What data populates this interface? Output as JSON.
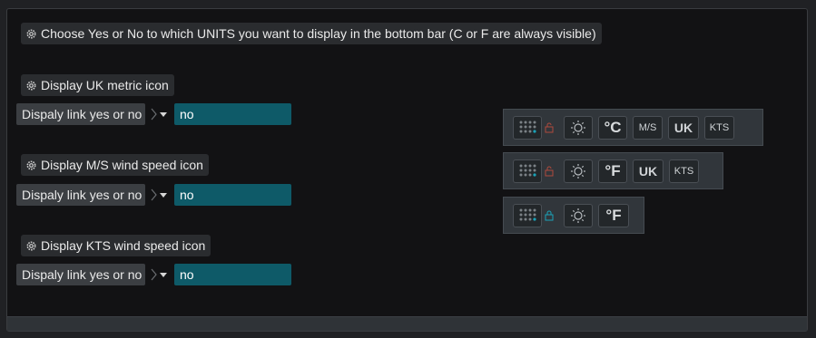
{
  "header": {
    "title": "Choose Yes or No to which UNITS you want to display in the bottom bar (C or F are always visible)",
    "icon": "gear-icon"
  },
  "sections": [
    {
      "heading": "Display UK metric icon",
      "row_label": "Dispaly link yes or no",
      "value": "no"
    },
    {
      "heading": "Display M/S wind speed icon",
      "row_label": "Dispaly link yes or no",
      "value": "no"
    },
    {
      "heading": "Display KTS wind speed icon",
      "row_label": "Dispaly link yes or no",
      "value": "no"
    }
  ],
  "preview_bars": [
    {
      "lock_color": "#b04a3c",
      "items": [
        "grid-icon",
        "sun-icon",
        "°C",
        "M/S",
        "UK",
        "KTS"
      ]
    },
    {
      "lock_color": "#b04a3c",
      "items": [
        "grid-icon",
        "sun-icon",
        "°F",
        "UK",
        "KTS"
      ]
    },
    {
      "lock_color": "#1aa3b8",
      "items": [
        "grid-icon",
        "sun-icon",
        "°F"
      ]
    }
  ],
  "bar1": {
    "c": "°C",
    "ms": "M/S",
    "uk": "UK",
    "kts": "KTS"
  },
  "bar2": {
    "f": "°F",
    "uk": "UK",
    "kts": "KTS"
  },
  "bar3": {
    "f": "°F"
  },
  "colors": {
    "background": "#121214",
    "select_teal": "#0e5a68",
    "accent_teal": "#1aa3b8",
    "lock_red": "#b04a3c"
  }
}
